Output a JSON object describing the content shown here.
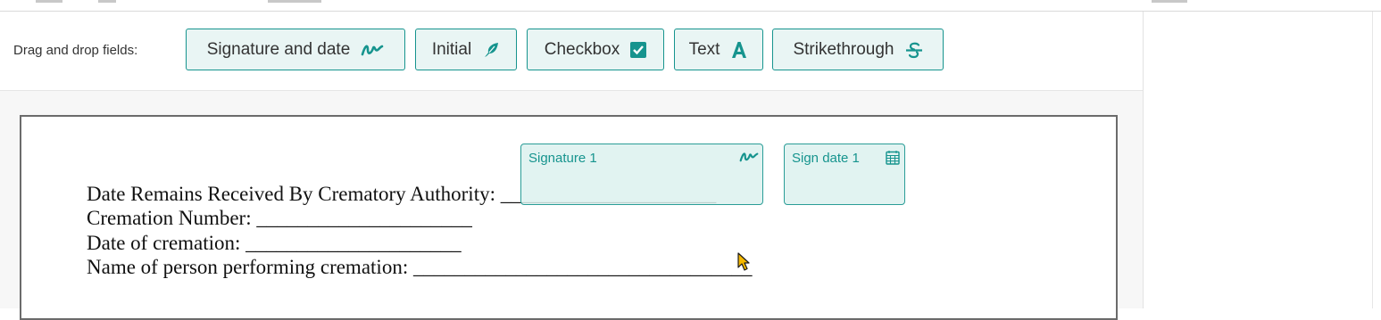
{
  "toolbar": {
    "label": "Drag and drop fields:",
    "fields": [
      {
        "label": "Signature and date",
        "icon": "signature-icon"
      },
      {
        "label": "Initial",
        "icon": "feather-icon"
      },
      {
        "label": "Checkbox",
        "icon": "checkbox-icon"
      },
      {
        "label": "Text",
        "icon": "text-a-icon"
      },
      {
        "label": "Strikethrough",
        "icon": "strikethrough-icon"
      }
    ]
  },
  "document": {
    "lines": [
      "Date Remains Received By Crematory Authority: _____________________",
      "Cremation Number: _____________________",
      "Date of cremation: _____________________",
      "Name of person performing cremation: _________________________________"
    ]
  },
  "placed_fields": {
    "signature": {
      "label": "Signature 1",
      "icon": "signature-icon"
    },
    "sign_date": {
      "label": "Sign date 1",
      "icon": "calendar-icon"
    }
  },
  "colors": {
    "accent": "#16948e",
    "field_bg": "#e9f5f4",
    "cursor": "#f5b800"
  }
}
